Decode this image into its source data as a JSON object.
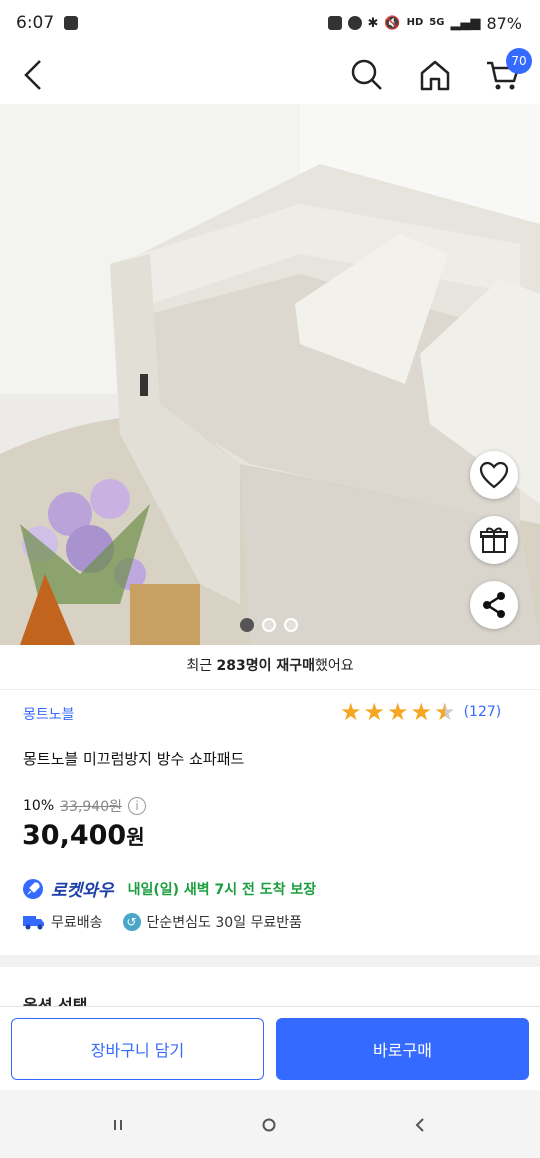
{
  "status_bar": {
    "time": "6:07",
    "network_hd": "HD",
    "network_5g": "5G",
    "battery": "87%"
  },
  "header": {
    "cart_count": "70"
  },
  "gallery": {
    "image_description_icons": [
      "heart-icon",
      "gift-icon",
      "share-icon"
    ],
    "page_count": 3,
    "active_index": 0
  },
  "repurchase": {
    "prefix": "최근 ",
    "count": "283명이 재구매",
    "suffix": "했어요"
  },
  "product": {
    "brand": "몽트노블",
    "rating": 4.5,
    "review_count": "(127)",
    "title": "몽트노블 미끄럼방지 방수 쇼파패드",
    "discount": "10%",
    "original_price": "33,940원",
    "price": "30,400",
    "price_unit": "원"
  },
  "delivery": {
    "rocket_name": "로켓와우",
    "eta": "내일(일) 새벽 7시 전 도착 보장",
    "free_shipping": "무료배송",
    "return_policy": "단순변심도 30일 무료반품"
  },
  "options": {
    "title": "옵션 선택"
  },
  "actions": {
    "add_to_cart": "장바구니 담기",
    "buy_now": "바로구매"
  },
  "colors": {
    "accent": "#346aff",
    "rocket_eta": "#1b9e3e",
    "star": "#f5a623"
  }
}
